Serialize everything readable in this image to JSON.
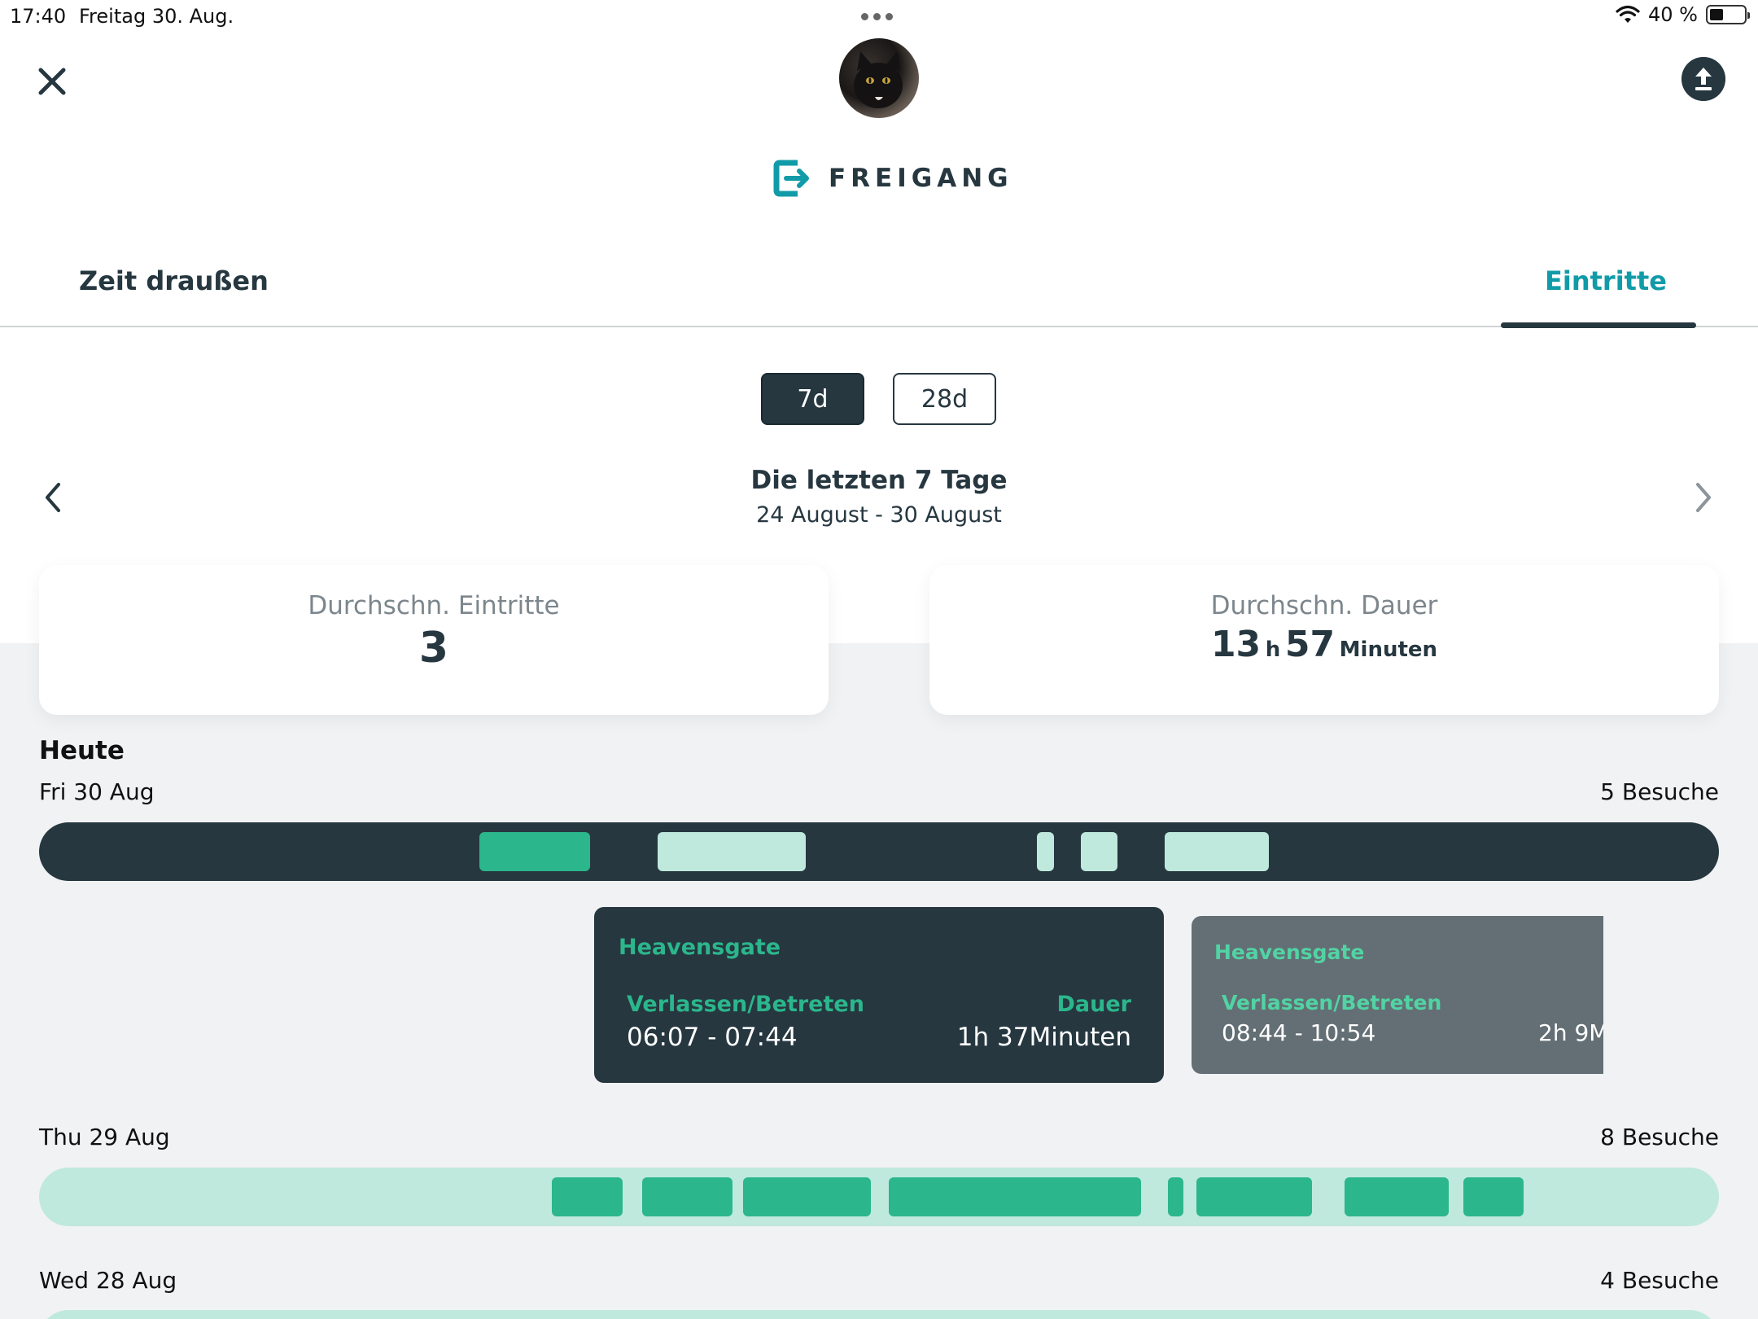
{
  "status_bar": {
    "time": "17:40",
    "date": "Freitag 30. Aug.",
    "battery": "40 %"
  },
  "header": {
    "brand_title": "FREIGANG",
    "close_icon": "close-icon",
    "upload_icon": "upload-icon",
    "brand_icon": "exit-door-icon"
  },
  "tabs": [
    {
      "label": "Zeit draußen",
      "active": false
    },
    {
      "label": "Eintritte",
      "active": true
    }
  ],
  "range_toggle": [
    {
      "label": "7d",
      "selected": true
    },
    {
      "label": "28d",
      "selected": false
    }
  ],
  "period": {
    "title": "Die letzten 7 Tage",
    "range": "24 August - 30 August"
  },
  "stats": {
    "avg_entries_label": "Durchschn. Eintritte",
    "avg_entries_value": "3",
    "avg_duration_label": "Durchschn. Dauer",
    "avg_duration_hours": "13",
    "hours_unit": "h",
    "avg_duration_minutes": "57",
    "minutes_unit": "Minuten"
  },
  "days_heading": "Heute",
  "days": [
    {
      "label": "Fri 30 Aug",
      "visits": "5 Besuche",
      "segments": [
        {
          "start": 0.262,
          "end": 0.328,
          "state": "selected"
        },
        {
          "start": 0.368,
          "end": 0.456,
          "state": "normal"
        },
        {
          "start": 0.594,
          "end": 0.604,
          "state": "normal"
        },
        {
          "start": 0.62,
          "end": 0.642,
          "state": "normal"
        },
        {
          "start": 0.67,
          "end": 0.732,
          "state": "normal"
        }
      ]
    },
    {
      "label": "Thu 29 Aug",
      "visits": "8 Besuche",
      "segments": [
        {
          "start": 0.305,
          "end": 0.347,
          "state": "normal"
        },
        {
          "start": 0.359,
          "end": 0.413,
          "state": "normal"
        },
        {
          "start": 0.419,
          "end": 0.495,
          "state": "normal"
        },
        {
          "start": 0.506,
          "end": 0.656,
          "state": "normal"
        },
        {
          "start": 0.672,
          "end": 0.681,
          "state": "normal"
        },
        {
          "start": 0.689,
          "end": 0.758,
          "state": "normal"
        },
        {
          "start": 0.777,
          "end": 0.839,
          "state": "normal"
        },
        {
          "start": 0.848,
          "end": 0.884,
          "state": "normal"
        }
      ]
    },
    {
      "label": "Wed 28 Aug",
      "visits": "4 Besuche",
      "segments": []
    }
  ],
  "tooltips": [
    {
      "place": "Heavensgate",
      "range_label": "Verlassen/Betreten",
      "range": "06:07 - 07:44",
      "duration_label": "Dauer",
      "duration": "1h 37Minuten"
    },
    {
      "place": "Heavensgate",
      "range_label": "Verlassen/Betreten",
      "range": "08:44 - 10:54",
      "duration": "2h 9M"
    }
  ],
  "colors": {
    "dark": "#263740",
    "teal": "#119ba8",
    "green": "#2bb68b",
    "mint": "#bfe9dc",
    "background": "#f1f2f4"
  }
}
